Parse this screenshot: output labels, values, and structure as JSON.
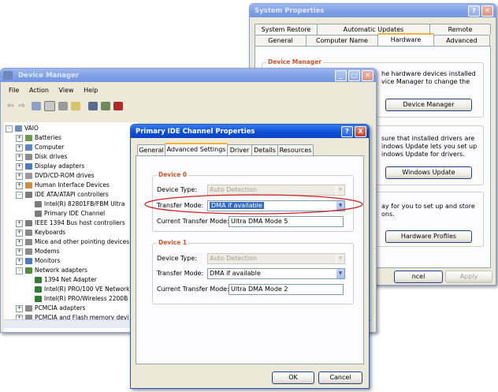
{
  "system_properties": {
    "title": "System Properties",
    "tabs_row1": [
      "System Restore",
      "Automatic Updates",
      "Remote"
    ],
    "tabs_row2": [
      "General",
      "Computer Name",
      "Hardware",
      "Advanced"
    ],
    "device_manager_group": "Device Manager",
    "dm_text": [
      "he hardware devices installed",
      "vice Manager to change the"
    ],
    "dm_button": "Device Manager",
    "drivers_text": [
      "sure that installed drivers are",
      "indows Update lets you set up",
      "indows Update for drivers."
    ],
    "wu_button": "Windows Update",
    "profiles_text": [
      "ay for you to set up and store",
      "ons."
    ],
    "profiles_button": "Hardware Profiles",
    "cancel": "ncel",
    "apply": "Apply"
  },
  "device_manager": {
    "title": "Device Manager",
    "menu": [
      "File",
      "Action",
      "View",
      "Help"
    ],
    "tree": [
      {
        "label": "VAIO",
        "level": 0,
        "expander": "-",
        "color": "#6b8fb8"
      },
      {
        "label": "Batteries",
        "level": 1,
        "expander": "+",
        "color": "#6c9c4a"
      },
      {
        "label": "Computer",
        "level": 1,
        "expander": "+",
        "color": "#5c86c0"
      },
      {
        "label": "Disk drives",
        "level": 1,
        "expander": "+",
        "color": "#8c8c8c"
      },
      {
        "label": "Display adapters",
        "level": 1,
        "expander": "+",
        "color": "#4a7cc2"
      },
      {
        "label": "DVD/CD-ROM drives",
        "level": 1,
        "expander": "+",
        "color": "#9a9a9a"
      },
      {
        "label": "Human Interface Devices",
        "level": 1,
        "expander": "+",
        "color": "#c98f3a"
      },
      {
        "label": "IDE ATA/ATAPI controllers",
        "level": 1,
        "expander": "-",
        "color": "#7c7c7c"
      },
      {
        "label": "Intel(R) 82801FB/FBM Ultra",
        "level": 2,
        "expander": "",
        "color": "#7c7c7c"
      },
      {
        "label": "Primary IDE Channel",
        "level": 2,
        "expander": "",
        "color": "#7c7c7c"
      },
      {
        "label": "IEEE 1394 Bus host controllers",
        "level": 1,
        "expander": "+",
        "color": "#7c7c7c"
      },
      {
        "label": "Keyboards",
        "level": 1,
        "expander": "+",
        "color": "#8a8a8a"
      },
      {
        "label": "Mice and other pointing devices",
        "level": 1,
        "expander": "+",
        "color": "#8a8a8a"
      },
      {
        "label": "Modems",
        "level": 1,
        "expander": "+",
        "color": "#8a8a8a"
      },
      {
        "label": "Monitors",
        "level": 1,
        "expander": "+",
        "color": "#4a7cc2"
      },
      {
        "label": "Network adapters",
        "level": 1,
        "expander": "-",
        "color": "#4f8f3a"
      },
      {
        "label": "1394 Net Adapter",
        "level": 2,
        "expander": "",
        "color": "#2f7d2f"
      },
      {
        "label": "Intel(R) PRO/100 VE Network",
        "level": 2,
        "expander": "",
        "color": "#2f7d2f"
      },
      {
        "label": "Intel(R) PRO/Wireless 2200B",
        "level": 2,
        "expander": "",
        "color": "#2f7d2f"
      },
      {
        "label": "PCMCIA adapters",
        "level": 1,
        "expander": "+",
        "color": "#8a8a8a"
      },
      {
        "label": "PCMCIA and Flash memory devi",
        "level": 1,
        "expander": "+",
        "color": "#8a8a8a"
      }
    ]
  },
  "ide_props": {
    "title": "Primary IDE Channel Properties",
    "help": "?",
    "close": "X",
    "tabs": [
      "General",
      "Advanced Settings",
      "Driver",
      "Details",
      "Resources"
    ],
    "device0": {
      "heading": "Device 0",
      "device_type_label": "Device Type:",
      "device_type_value": "Auto Detection",
      "transfer_mode_label": "Transfer Mode:",
      "transfer_mode_value": "DMA if available",
      "current_mode_label": "Current Transfer Mode:",
      "current_mode_value": "Ultra DMA Mode 5"
    },
    "device1": {
      "heading": "Device 1",
      "device_type_label": "Device Type:",
      "device_type_value": "Auto Detection",
      "transfer_mode_label": "Transfer Mode:",
      "transfer_mode_value": "DMA if available",
      "current_mode_label": "Current Transfer Mode:",
      "current_mode_value": "Ultra DMA Mode 2"
    },
    "ok": "OK",
    "cancel": "Cancel"
  },
  "colors": {
    "highlight_ellipse": "#d02020",
    "selection": "#316ac5",
    "group_title": "#d1542b"
  }
}
